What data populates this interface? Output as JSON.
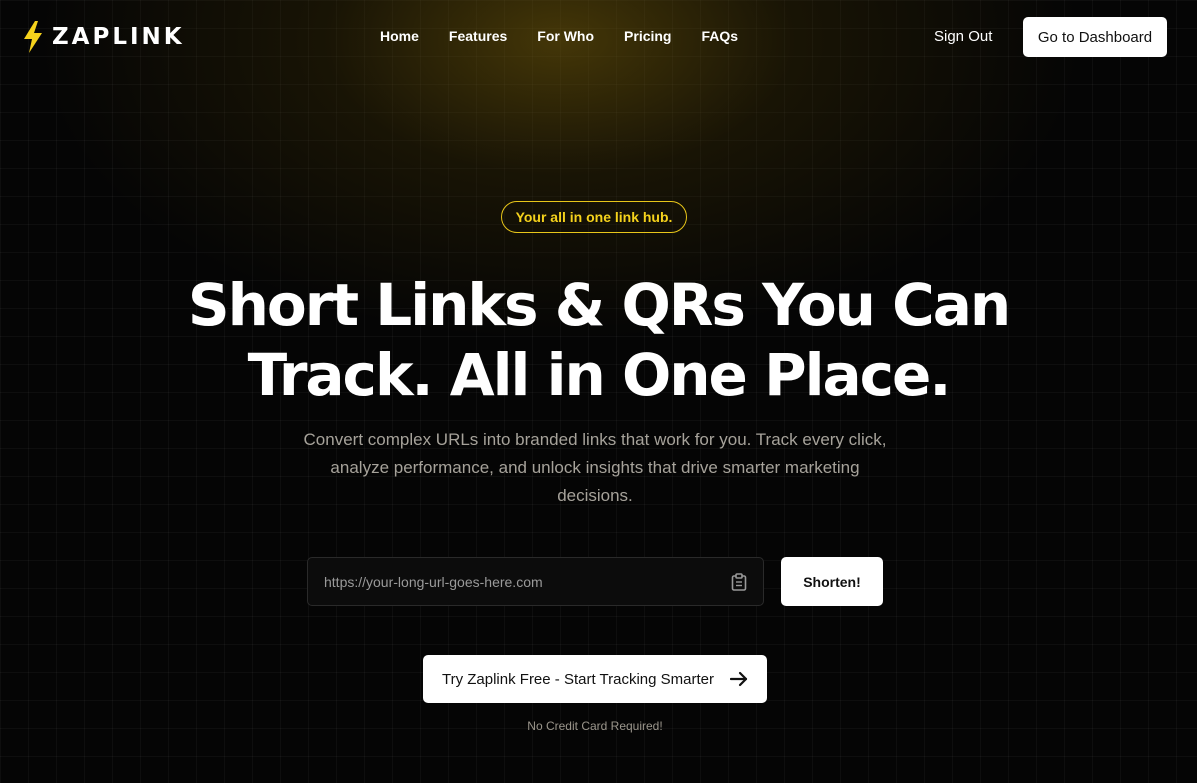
{
  "brand": {
    "name": "ZAPLINK",
    "icon": "lightning-bolt-icon",
    "accent_color": "#f5d21c"
  },
  "nav": {
    "items": [
      {
        "label": "Home"
      },
      {
        "label": "Features"
      },
      {
        "label": "For Who"
      },
      {
        "label": "Pricing"
      },
      {
        "label": "FAQs"
      }
    ]
  },
  "header": {
    "sign_out_label": "Sign Out",
    "dashboard_label": "Go to Dashboard"
  },
  "hero": {
    "badge": "Your all in one link hub.",
    "headline_line1": "Short Links & QRs You Can",
    "headline_line2": "Track. All in One Place.",
    "subtitle": "Convert complex URLs into branded links that work for you. Track every click, analyze performance, and unlock insights that drive smarter marketing decisions."
  },
  "shortener": {
    "placeholder": "https://your-long-url-goes-here.com",
    "value": "",
    "paste_icon": "clipboard-icon",
    "submit_label": "Shorten!"
  },
  "cta": {
    "label": "Try Zaplink Free - Start Tracking Smarter",
    "icon": "arrow-right-icon",
    "note": "No Credit Card Required!"
  }
}
